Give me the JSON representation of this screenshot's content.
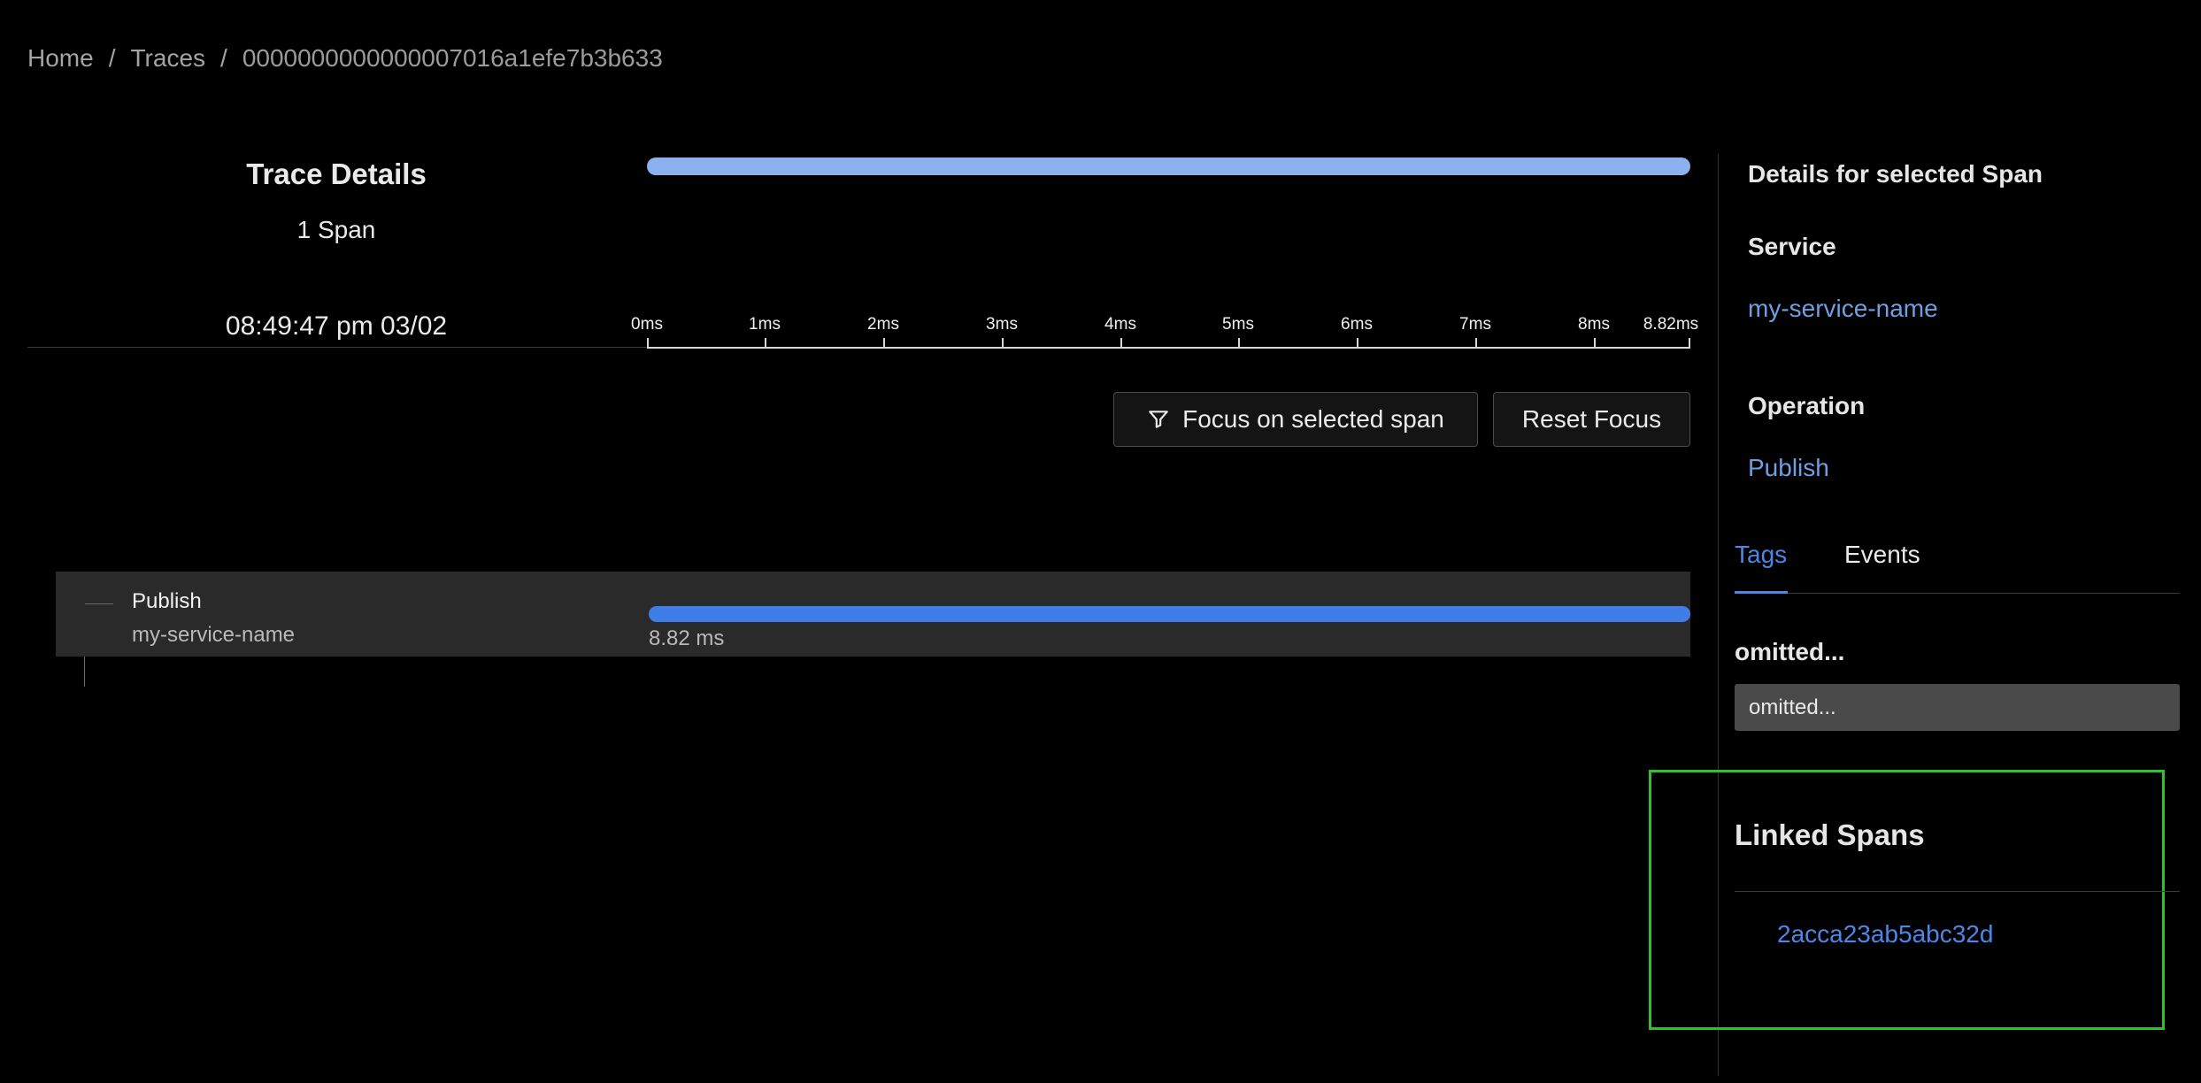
{
  "breadcrumb": {
    "home": "Home",
    "separator": "/",
    "traces": "Traces",
    "trace_id": "0000000000000007016a1efe7b3b633"
  },
  "trace": {
    "title": "Trace Details",
    "span_count": "1 Span",
    "timestamp": "08:49:47 pm 03/02"
  },
  "timeline": {
    "ticks": [
      "0ms",
      "1ms",
      "2ms",
      "3ms",
      "4ms",
      "5ms",
      "6ms",
      "7ms",
      "8ms",
      "8.82ms"
    ]
  },
  "actions": {
    "focus_label": "Focus on selected span",
    "focus_icon": "filter-icon",
    "reset_label": "Reset Focus"
  },
  "span": {
    "operation": "Publish",
    "service": "my-service-name",
    "duration": "8.82 ms"
  },
  "details": {
    "title": "Details for selected Span",
    "service_label": "Service",
    "service_value": "my-service-name",
    "operation_label": "Operation",
    "operation_value": "Publish",
    "tabs": [
      {
        "label": "Tags",
        "active": true
      },
      {
        "label": "Events",
        "active": false
      }
    ],
    "tag_key": "omitted...",
    "tag_value": "omitted..."
  },
  "linked_spans": {
    "title": "Linked Spans",
    "items": [
      "2acca23ab5abc32d"
    ]
  },
  "colors": {
    "accent": "#4d86e8",
    "overview_bar": "#8cb1ee",
    "span_bar": "#3f7ee8",
    "highlight": "#2fbf2f"
  }
}
